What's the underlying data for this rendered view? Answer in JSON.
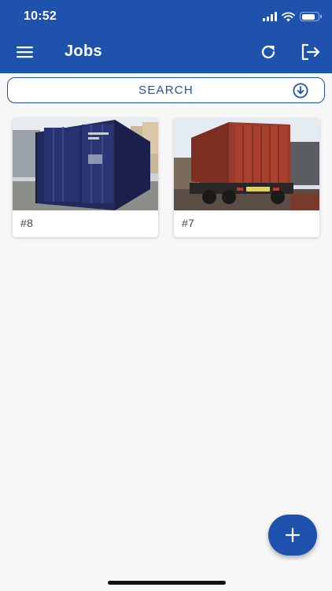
{
  "status_bar": {
    "time": "10:52"
  },
  "header": {
    "title": "Jobs"
  },
  "search": {
    "label": "SEARCH"
  },
  "jobs": [
    {
      "label": "#8",
      "image": "blue shipping container"
    },
    {
      "label": "#7",
      "image": "red shipping container on truck"
    }
  ],
  "icons": {
    "menu": "hamburger-menu-icon",
    "refresh": "refresh-icon",
    "logout": "logout-icon",
    "download": "download-circle-icon",
    "add": "plus-icon"
  },
  "colors": {
    "primary": "#1f52ac",
    "background": "#f7f7f8"
  }
}
